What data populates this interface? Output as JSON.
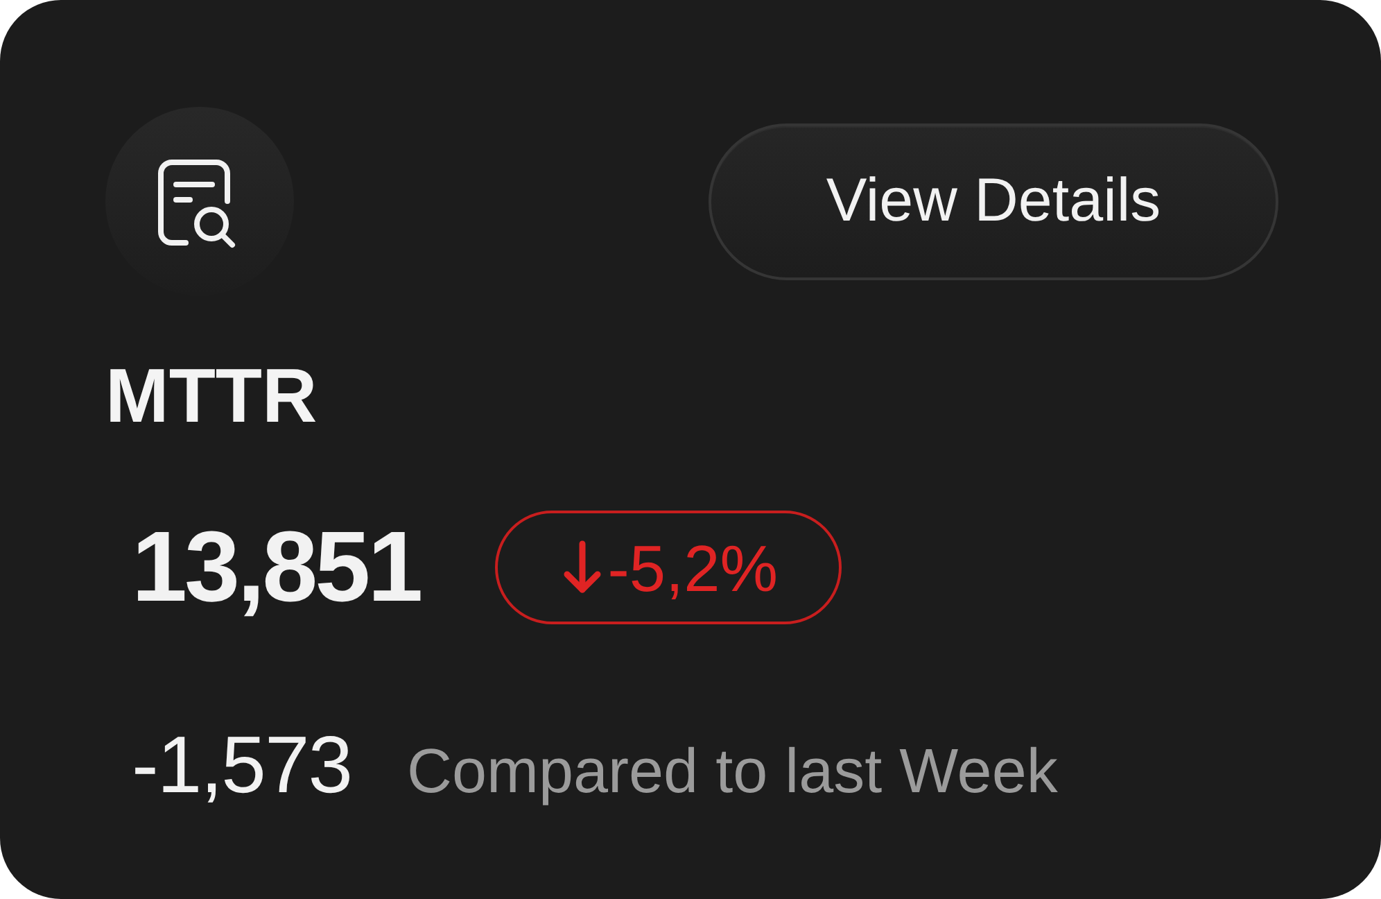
{
  "header": {
    "button": {
      "label": "View Details"
    }
  },
  "metric": {
    "title": "MTTR",
    "value": "13,851",
    "change": {
      "negative": true,
      "text": "-5,2%"
    },
    "delta": "-1,573",
    "comparison": "Compared to last Week"
  }
}
